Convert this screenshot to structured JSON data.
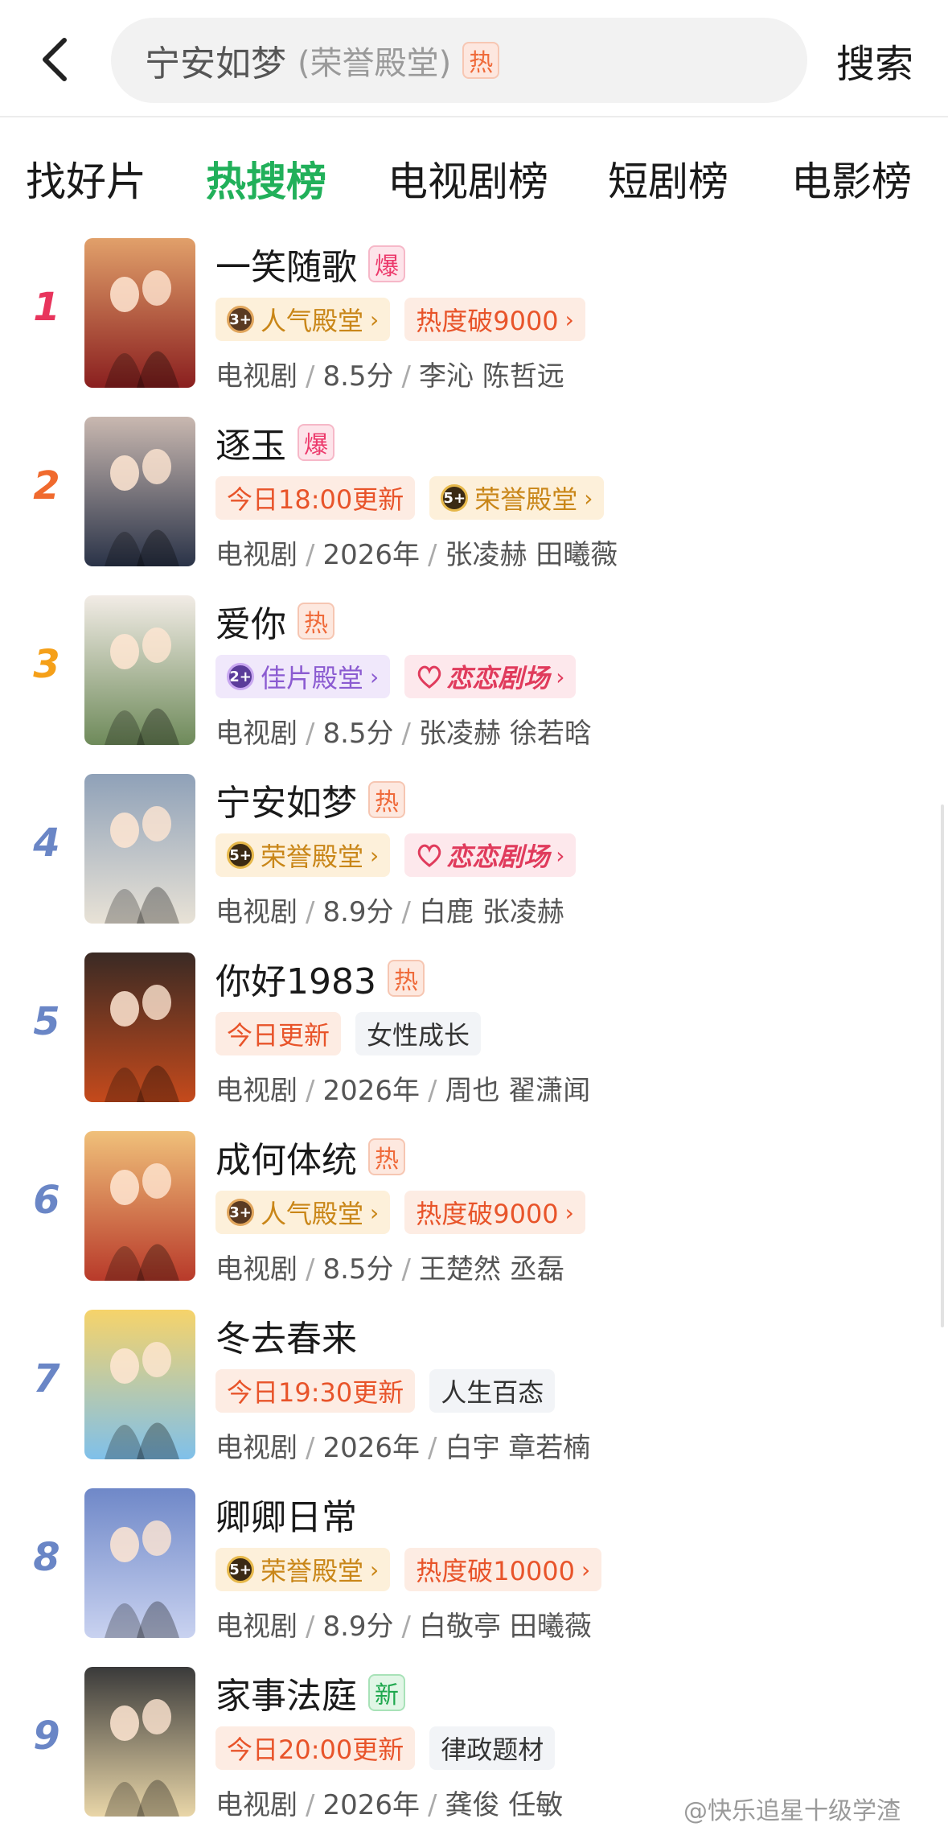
{
  "header": {
    "search_main": "宁安如梦",
    "search_sub": "(荣誉殿堂)",
    "search_badge": "热",
    "search_button": "搜索"
  },
  "tabs": [
    {
      "label": "找好片",
      "active": false
    },
    {
      "label": "热搜榜",
      "active": true
    },
    {
      "label": "电视剧榜",
      "active": false
    },
    {
      "label": "短剧榜",
      "active": false
    },
    {
      "label": "电影榜",
      "active": false
    }
  ],
  "colors": {
    "rank1": "#e8345c",
    "rank2": "#f06a2e",
    "rank3": "#f5a019",
    "rank_other": "#6a86c6",
    "active_tab": "#21b05a"
  },
  "items": [
    {
      "rank": "1",
      "title": "一笑随歌",
      "flag": "爆",
      "flag_type": "bao",
      "tags": [
        {
          "text": "人气殿堂",
          "type": "gold",
          "medal": "3+",
          "medal_type": "m3",
          "chev": "›"
        },
        {
          "text": "热度破9000",
          "type": "orange",
          "chev": "›"
        }
      ],
      "meta": [
        "电视剧",
        "8.5分",
        "李沁 陈哲远"
      ]
    },
    {
      "rank": "2",
      "title": "逐玉",
      "flag": "爆",
      "flag_type": "bao",
      "tags": [
        {
          "text": "今日18:00更新",
          "type": "orange"
        },
        {
          "text": "荣誉殿堂",
          "type": "gold",
          "medal": "5+",
          "medal_type": "m5",
          "chev": "›"
        }
      ],
      "meta": [
        "电视剧",
        "2026年",
        "张凌赫 田曦薇"
      ]
    },
    {
      "rank": "3",
      "title": "爱你",
      "flag": "热",
      "flag_type": "re",
      "tags": [
        {
          "text": "佳片殿堂",
          "type": "purple",
          "medal": "2+",
          "medal_type": "m2",
          "chev": "›"
        },
        {
          "text": "恋恋剧场",
          "type": "brand",
          "brand": true,
          "chev": "›"
        }
      ],
      "meta": [
        "电视剧",
        "8.5分",
        "张凌赫 徐若晗"
      ]
    },
    {
      "rank": "4",
      "title": "宁安如梦",
      "flag": "热",
      "flag_type": "re",
      "tags": [
        {
          "text": "荣誉殿堂",
          "type": "gold",
          "medal": "5+",
          "medal_type": "m5",
          "chev": "›"
        },
        {
          "text": "恋恋剧场",
          "type": "brand",
          "brand": true,
          "chev": "›"
        }
      ],
      "meta": [
        "电视剧",
        "8.9分",
        "白鹿 张凌赫"
      ]
    },
    {
      "rank": "5",
      "title": "你好1983",
      "flag": "热",
      "flag_type": "re",
      "tags": [
        {
          "text": "今日更新",
          "type": "orange"
        },
        {
          "text": "女性成长",
          "type": "gray"
        }
      ],
      "meta": [
        "电视剧",
        "2026年",
        "周也 翟潇闻"
      ]
    },
    {
      "rank": "6",
      "title": "成何体统",
      "flag": "热",
      "flag_type": "re",
      "tags": [
        {
          "text": "人气殿堂",
          "type": "gold",
          "medal": "3+",
          "medal_type": "m3",
          "chev": "›"
        },
        {
          "text": "热度破9000",
          "type": "orange",
          "chev": "›"
        }
      ],
      "meta": [
        "电视剧",
        "8.5分",
        "王楚然 丞磊"
      ]
    },
    {
      "rank": "7",
      "title": "冬去春来",
      "flag": "",
      "flag_type": "",
      "tags": [
        {
          "text": "今日19:30更新",
          "type": "orange"
        },
        {
          "text": "人生百态",
          "type": "gray"
        }
      ],
      "meta": [
        "电视剧",
        "2026年",
        "白宇 章若楠"
      ]
    },
    {
      "rank": "8",
      "title": "卿卿日常",
      "flag": "",
      "flag_type": "",
      "tags": [
        {
          "text": "荣誉殿堂",
          "type": "gold",
          "medal": "5+",
          "medal_type": "m5",
          "chev": "›"
        },
        {
          "text": "热度破10000",
          "type": "orange",
          "chev": "›"
        }
      ],
      "meta": [
        "电视剧",
        "8.9分",
        "白敬亭 田曦薇"
      ]
    },
    {
      "rank": "9",
      "title": "家事法庭",
      "flag": "新",
      "flag_type": "xin",
      "tags": [
        {
          "text": "今日20:00更新",
          "type": "orange"
        },
        {
          "text": "律政题材",
          "type": "gray"
        }
      ],
      "meta": [
        "电视剧",
        "2026年",
        "龚俊 任敏"
      ]
    }
  ],
  "watermark": "@快乐追星十级学渣"
}
